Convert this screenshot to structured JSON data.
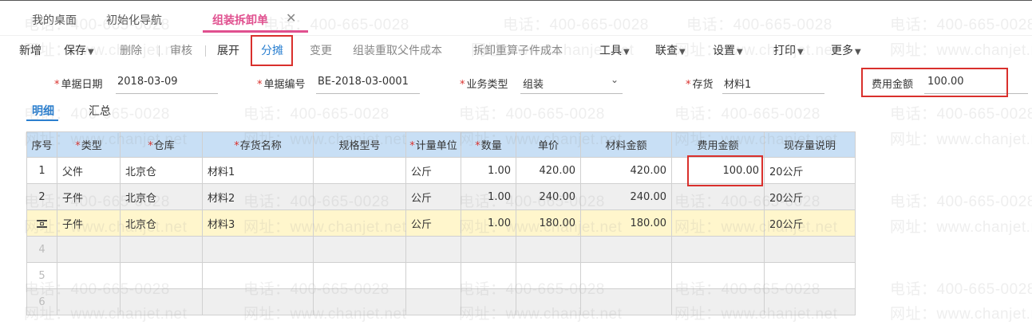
{
  "tabs": [
    {
      "label": "我的桌面"
    },
    {
      "label": "初始化导航"
    },
    {
      "label": "组装拆卸单"
    }
  ],
  "toolbar": {
    "new": "新增",
    "save": "保存",
    "delete": "删除",
    "audit": "审核",
    "expand": "展开",
    "allocate": "分摊",
    "change": "变更",
    "regather_parent": "组装重取父件成本",
    "recalc_child": "拆卸重算子件成本",
    "tools": "工具",
    "link": "联查",
    "settings": "设置",
    "print": "打印",
    "more": "更多"
  },
  "form": {
    "date_label": "单据日期",
    "date_value": "2018-03-09",
    "number_label": "单据编号",
    "number_value": "BE-2018-03-0001",
    "biztype_label": "业务类型",
    "biztype_value": "组装",
    "inventory_label": "存货",
    "inventory_value": "材料1",
    "fee_label": "费用金额",
    "fee_value": "100.00"
  },
  "subtabs": {
    "detail": "明细",
    "summary": "汇总"
  },
  "table": {
    "headers": {
      "seq": "序号",
      "type": "类型",
      "warehouse": "仓库",
      "inventory_name": "存货名称",
      "spec": "规格型号",
      "unit": "计量单位",
      "qty": "数量",
      "price": "单价",
      "material_amount": "材料金额",
      "fee_amount": "费用金额",
      "stock_note": "现存量说明"
    },
    "rows": [
      {
        "seq": "1",
        "type": "父件",
        "warehouse": "北京仓",
        "name": "材料1",
        "spec": "",
        "unit": "公斤",
        "qty": "1.00",
        "price": "420.00",
        "amount": "420.00",
        "fee": "100.00",
        "note": "20公斤"
      },
      {
        "seq": "2",
        "type": "子件",
        "warehouse": "北京仓",
        "name": "材料2",
        "spec": "",
        "unit": "公斤",
        "qty": "1.00",
        "price": "240.00",
        "amount": "240.00",
        "fee": "",
        "note": "20公斤"
      },
      {
        "seq": "",
        "type": "子件",
        "warehouse": "北京仓",
        "name": "材料3",
        "spec": "",
        "unit": "公斤",
        "qty": "1.00",
        "price": "180.00",
        "amount": "180.00",
        "fee": "",
        "note": "20公斤"
      },
      {
        "seq": "4",
        "type": "",
        "warehouse": "",
        "name": "",
        "spec": "",
        "unit": "",
        "qty": "",
        "price": "",
        "amount": "",
        "fee": "",
        "note": ""
      },
      {
        "seq": "5",
        "type": "",
        "warehouse": "",
        "name": "",
        "spec": "",
        "unit": "",
        "qty": "",
        "price": "",
        "amount": "",
        "fee": "",
        "note": ""
      },
      {
        "seq": "6",
        "type": "",
        "warehouse": "",
        "name": "",
        "spec": "",
        "unit": "",
        "qty": "",
        "price": "",
        "amount": "",
        "fee": "",
        "note": ""
      }
    ]
  },
  "watermark": {
    "phone": "电话：400-665-0028",
    "site": "网址：www.chanjet.net"
  },
  "colors": {
    "accent_pink": "#e0508f",
    "accent_blue": "#2a7fd0",
    "highlight_red": "#d9302c",
    "header_blue": "#c8dff5",
    "selected_row": "#fff6cc"
  }
}
